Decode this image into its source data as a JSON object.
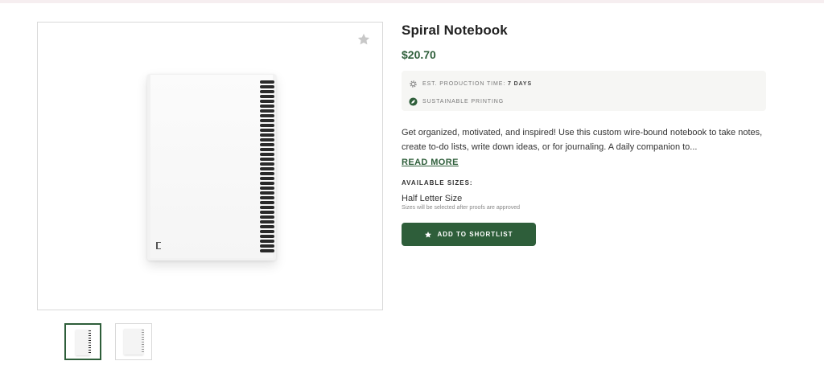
{
  "product": {
    "title": "Spiral Notebook",
    "price": "$20.70",
    "meta": {
      "production_label": "EST. PRODUCTION TIME: ",
      "production_value": "7 DAYS",
      "sustainable_label": "SUSTAINABLE PRINTING"
    },
    "description": "Get organized, motivated, and inspired! Use this custom wire-bound notebook to take notes, create to-do lists, write down ideas, or for journaling. A daily companion to...",
    "read_more": "READ MORE",
    "sizes": {
      "label": "AVAILABLE SIZES:",
      "value": "Half Letter Size",
      "note": "Sizes will be selected after proofs are approved"
    },
    "cta": {
      "label": "ADD TO SHORTLIST"
    }
  },
  "gallery": {
    "thumbnails": [
      {
        "state": "active"
      },
      {
        "state": "inactive"
      }
    ]
  },
  "icons": {
    "favorite": "star-icon",
    "production": "gear-icon",
    "sustainable": "leaf-icon",
    "cta": "star-icon"
  },
  "colors": {
    "accent": "#2e5e3a",
    "meta_bg": "#f6f6f4",
    "favorite_star": "#c8c8c8"
  }
}
